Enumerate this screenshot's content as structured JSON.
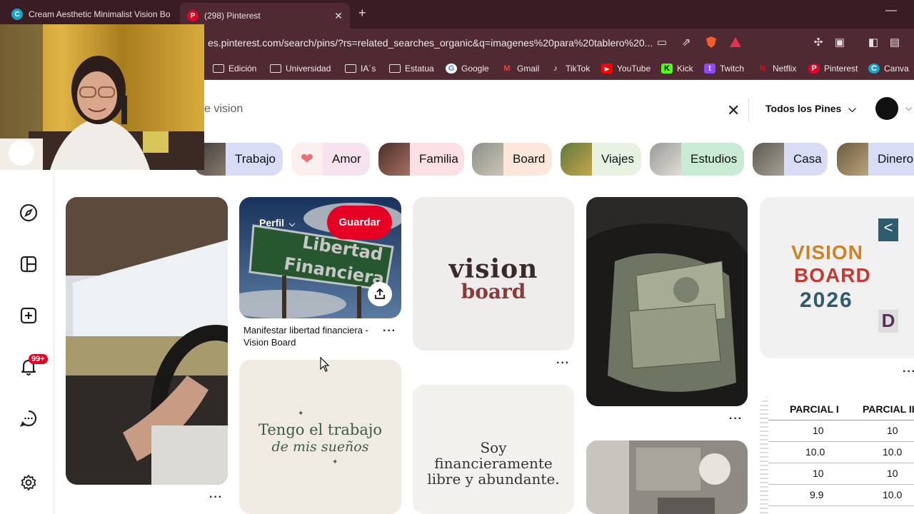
{
  "browser": {
    "tabs": [
      {
        "title": "Cream Aesthetic Minimalist Vision Bo",
        "active": false
      },
      {
        "title": "(298) Pinterest",
        "active": true
      }
    ],
    "url": "es.pinterest.com/search/pins/?rs=related_searches_organic&q=imagenes%20para%20tablero%20...",
    "bookmarks": [
      {
        "label": "Edición",
        "icon": "folder-icon"
      },
      {
        "label": "Universidad",
        "icon": "folder-icon"
      },
      {
        "label": "IA´s",
        "icon": "folder-icon"
      },
      {
        "label": "Estatua",
        "icon": "folder-icon"
      },
      {
        "label": "Google",
        "icon": "google-icon"
      },
      {
        "label": "Gmail",
        "icon": "gmail-icon"
      },
      {
        "label": "TikTok",
        "icon": "tiktok-icon"
      },
      {
        "label": "YouTube",
        "icon": "youtube-icon"
      },
      {
        "label": "Kick",
        "icon": "kick-icon"
      },
      {
        "label": "Twitch",
        "icon": "twitch-icon"
      },
      {
        "label": "Netflix",
        "icon": "netflix-icon"
      },
      {
        "label": "Pinterest",
        "icon": "pinterest-icon"
      },
      {
        "label": "Canva",
        "icon": "canva-icon"
      }
    ]
  },
  "search": {
    "query_visible": "e vision",
    "filter": "Todos los Pines"
  },
  "chips": [
    {
      "label": "Trabajo",
      "bg": "#d9dcf5"
    },
    {
      "label": "Amor",
      "bg": "#f6e3ee"
    },
    {
      "label": "Familia",
      "bg": "#fbe0e4"
    },
    {
      "label": "Board",
      "bg": "#fce7da"
    },
    {
      "label": "Viajes",
      "bg": "#e7f2e3"
    },
    {
      "label": "Estudios",
      "bg": "#c9ead4"
    },
    {
      "label": "Casa",
      "bg": "#d9dcf5"
    },
    {
      "label": "Dinero",
      "bg": "#d9dcf5"
    }
  ],
  "nav": {
    "notification_count": "99+"
  },
  "pins": {
    "hovered": {
      "profile_label": "Perfil",
      "save_label": "Guardar",
      "sign_text_line1": "Libertad",
      "sign_text_line2": "Financiera",
      "title": "Manifestar libertad financiera - Vision Board"
    },
    "vision_board_logo": {
      "line1": "vision",
      "line2": "board"
    },
    "vision_board_2026": {
      "line1": "VISION",
      "line2": "BOARD",
      "line3": "2026"
    },
    "quote_trabajo": {
      "line1": "Tengo el trabajo",
      "line2": "de mis sueños"
    },
    "quote_libre": {
      "line1": "Soy",
      "line2": "financieramente",
      "line3": "libre y abundante."
    },
    "grades_table": {
      "headers": [
        "PARCIAL I",
        "PARCIAL II"
      ],
      "rows": [
        [
          "10",
          "10"
        ],
        [
          "10.0",
          "10.0"
        ],
        [
          "10",
          "10"
        ],
        [
          "9.9",
          "10.0"
        ]
      ]
    },
    "more_label": "···"
  },
  "colors": {
    "pinterest_red": "#e60023",
    "chrome_dark": "#3a1d24",
    "chrome_mid": "#4f2a33"
  }
}
